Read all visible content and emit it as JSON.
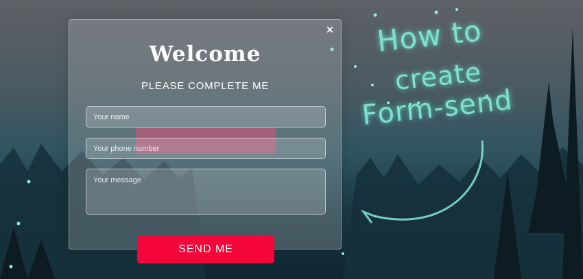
{
  "modal": {
    "close_symbol": "×",
    "title": "Welcome",
    "subtitle": "PLEASE COMPLETE ME",
    "name_placeholder": "Your name",
    "phone_placeholder": "Your phone number",
    "message_placeholder": "Your message",
    "send_label": "SEND ME"
  },
  "overlay": {
    "line1": "How to",
    "line2": "create",
    "line3": "Form-send"
  },
  "colors": {
    "button": "#f5063a",
    "glow_text": "#7fe0cf"
  }
}
